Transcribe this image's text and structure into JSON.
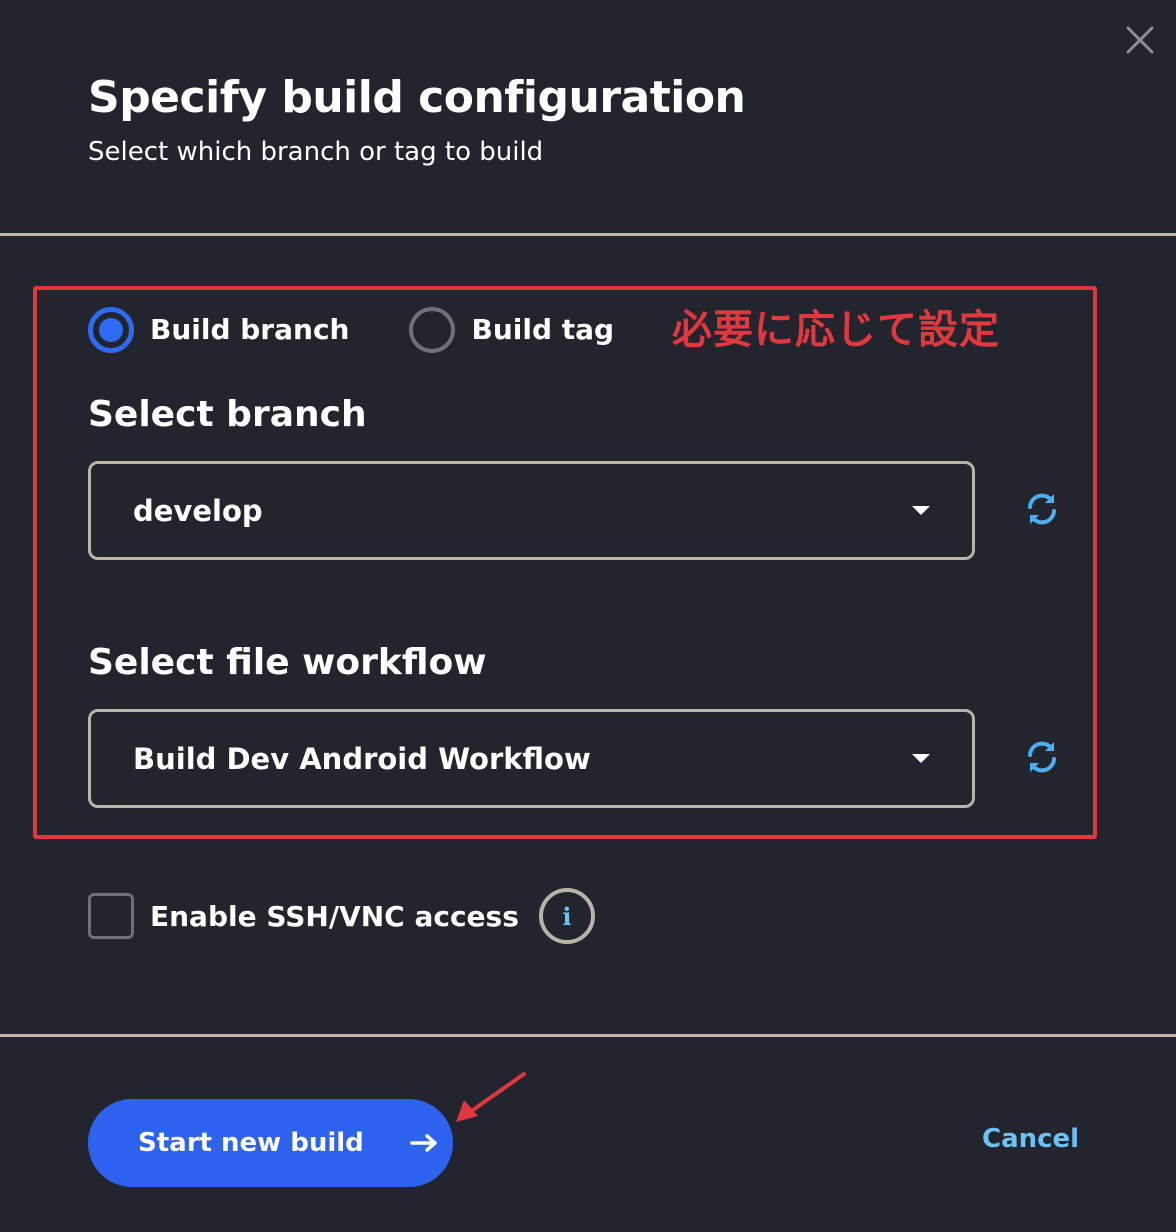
{
  "dialog": {
    "title": "Specify build configuration",
    "subtitle": "Select which branch or tag to build",
    "close_icon": "close-icon"
  },
  "build_type": {
    "options": [
      {
        "label": "Build branch",
        "selected": true
      },
      {
        "label": "Build tag",
        "selected": false
      }
    ]
  },
  "branch": {
    "label": "Select branch",
    "value": "develop",
    "refresh_icon": "refresh-icon"
  },
  "workflow": {
    "label": "Select file workflow",
    "value": "Build Dev Android Workflow",
    "refresh_icon": "refresh-icon"
  },
  "ssh": {
    "label": "Enable SSH/VNC access",
    "checked": false,
    "info_icon": "info-icon",
    "info_glyph": "i"
  },
  "footer": {
    "start_label": "Start new build",
    "start_icon": "arrow-right-icon",
    "cancel_label": "Cancel"
  },
  "annotation": {
    "text": "必要に応じて設定",
    "color": "#e0383e"
  },
  "colors": {
    "background": "#22252e",
    "primary": "#2d63ef",
    "link": "#6ec1f4",
    "border": "#bcb3a8"
  }
}
